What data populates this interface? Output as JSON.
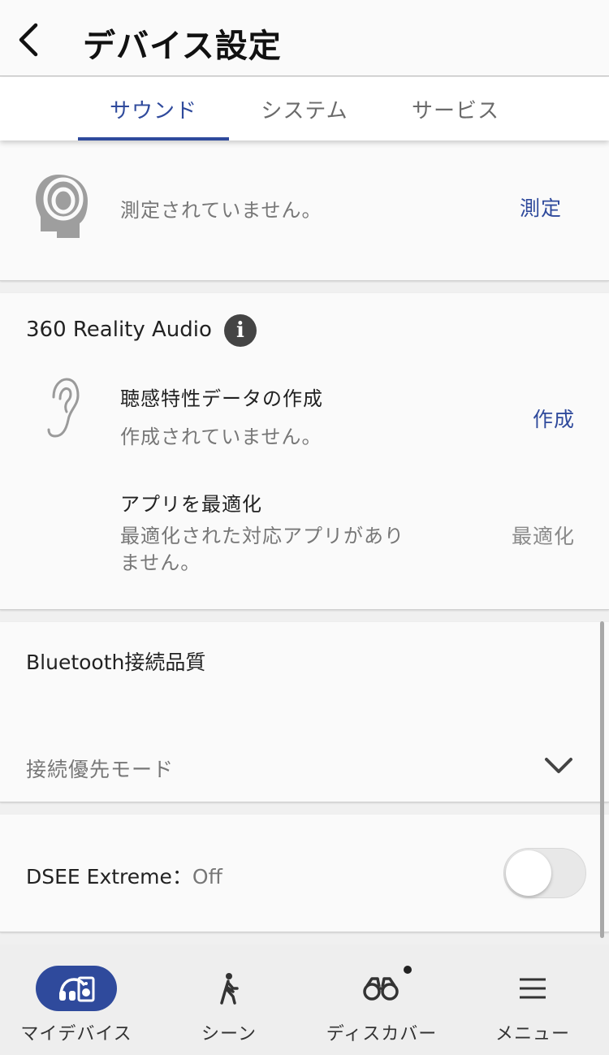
{
  "header": {
    "title": "デバイス設定",
    "back_icon": "chevron-left-icon"
  },
  "tabs": [
    {
      "label": "サウンド",
      "active": true
    },
    {
      "label": "システム",
      "active": false
    },
    {
      "label": "サービス",
      "active": false
    }
  ],
  "measure": {
    "icon": "head-headphones-icon",
    "status": "測定されていません。",
    "action": "測定"
  },
  "reality_audio": {
    "title": "360 Reality Audio",
    "info_icon": "info-icon",
    "hearing": {
      "icon": "ear-icon",
      "title": "聴感特性データの作成",
      "status": "作成されていません。",
      "action": "作成"
    },
    "optimize": {
      "icon": "play-icon",
      "title": "アプリを最適化",
      "status_line1": "最適化された対応アプリがあり",
      "status_line2": "ません。",
      "action": "最適化"
    }
  },
  "bluetooth": {
    "title": "Bluetooth接続品質",
    "mode_label": "接続優先モード",
    "dropdown_icon": "chevron-down-icon"
  },
  "dsee": {
    "label": "DSEE Extreme：",
    "value": "Off",
    "enabled": false
  },
  "bottom_nav": [
    {
      "label": "マイデバイス",
      "icon": "headphones-device-icon",
      "active": true
    },
    {
      "label": "シーン",
      "icon": "walking-person-icon",
      "active": false
    },
    {
      "label": "ディスカバー",
      "icon": "binoculars-icon",
      "active": false,
      "has_badge": true
    },
    {
      "label": "メニュー",
      "icon": "hamburger-menu-icon",
      "active": false
    }
  ],
  "colors": {
    "accent": "#2f4a9c",
    "background": "#f0f0f0",
    "card": "#fafafa",
    "muted_text": "#777777"
  }
}
